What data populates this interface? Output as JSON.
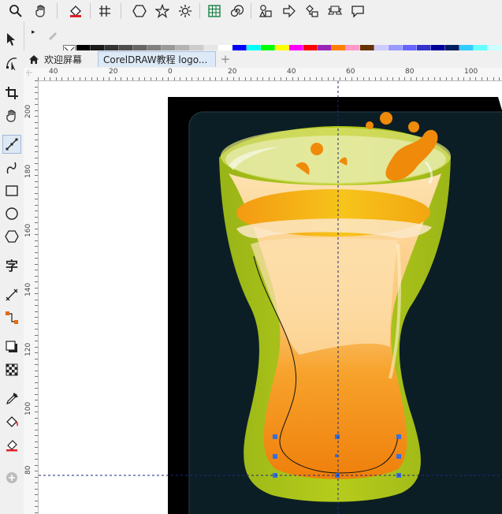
{
  "toolbar": {
    "icons": [
      "zoom-icon",
      "pan-hand-icon",
      "fill-icon",
      "snap-grid-icon",
      "hexagon-icon",
      "star-icon",
      "gear-star-icon",
      "table-icon",
      "spiral-icon",
      "shapes-icon",
      "arrow-shape-icon",
      "flowchart-icon",
      "banner-icon",
      "callout-icon"
    ]
  },
  "palette": {
    "row1": [
      "#000000",
      "#1a1a1a",
      "#333333",
      "#4d4d4d",
      "#666666",
      "#808080",
      "#999999",
      "#b3b3b3",
      "#cccccc",
      "#e6e6e6",
      "#ffffff",
      "#0000ff",
      "#00ffff",
      "#00ff00",
      "#ffff00",
      "#ff00ff",
      "#ff0000",
      "#9b26b6",
      "#ff7f00",
      "#ff99cc",
      "#663300",
      "#ccccff",
      "#9999ff",
      "#6666ff",
      "#3333cc",
      "#000099",
      "#001f5f",
      "#33ccff",
      "#66ffff",
      "#ccffff"
    ],
    "row2": [
      "#330066",
      "#663399",
      "#9900cc",
      "#6600cc",
      "#9933ff",
      "#3300cc",
      "#6633cc",
      "#330099"
    ]
  },
  "tabs": {
    "home_label": "欢迎屏幕",
    "doc_label": "CorelDRAW教程 logo...",
    "add_label": "+"
  },
  "toolbox": {
    "tools": [
      "pick-tool-icon",
      "shape-tool-icon",
      "crop-tool-icon",
      "pan-tool-icon",
      "freehand-tool-icon",
      "artistic-media-icon",
      "rectangle-tool-icon",
      "ellipse-tool-icon",
      "polygon-tool-icon",
      "text-tool-icon",
      "dimension-tool-icon",
      "connector-tool-icon",
      "drop-shadow-icon",
      "transparency-icon",
      "eyedropper-icon",
      "interactive-fill-icon",
      "smart-fill-icon",
      "add-tool-icon"
    ],
    "text_tool_glyph": "字"
  },
  "ruler": {
    "h_labels": [
      "40",
      "20",
      "0",
      "20",
      "40",
      "60",
      "80",
      "100"
    ],
    "v_labels": [
      "200",
      "180",
      "160",
      "140",
      "120",
      "100",
      "80"
    ]
  },
  "colors": {
    "canvas_bg": "#ffffff",
    "artboard_bg": "#000000",
    "card_bg": "#0d1f26",
    "outer_glass": "#a6c11a",
    "beer_orange": "#f08a0a",
    "beer_light": "#fbd38a",
    "node_blue": "#3a6fd8"
  }
}
